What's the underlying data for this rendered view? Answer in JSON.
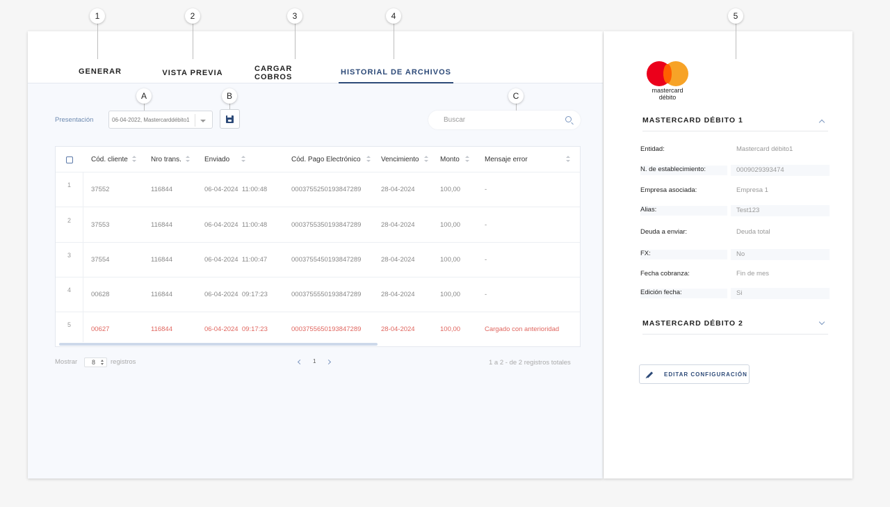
{
  "callouts": [
    "1",
    "2",
    "3",
    "4",
    "5",
    "A",
    "B",
    "C"
  ],
  "tabs": [
    {
      "label": "GENERAR",
      "active": false
    },
    {
      "label": "VISTA PREVIA",
      "active": false
    },
    {
      "label": "CARGAR COBROS",
      "active": false
    },
    {
      "label": "HISTORIAL DE ARCHIVOS",
      "active": true
    }
  ],
  "toolbar": {
    "presentacion_label": "Presentación",
    "presentacion_value": "06-04-2022, Mastercarddébito1",
    "search_placeholder": "Buscar"
  },
  "table": {
    "headers": [
      "Cód. cliente",
      "Nro trans.",
      "Enviado",
      "Cód. Pago Electrónico",
      "Vencimiento",
      "Monto",
      "Mensaje error"
    ],
    "rows": [
      {
        "idx": "1",
        "cliente": "37552",
        "trans": "116844",
        "enviado": "06-04-2024  11:00:48",
        "pago": "0003755250193847289",
        "venc": "28-04-2024",
        "monto": "100,00",
        "error": "-",
        "is_error": false
      },
      {
        "idx": "2",
        "cliente": "37553",
        "trans": "116844",
        "enviado": "06-04-2024  11:00:48",
        "pago": "0003755350193847289",
        "venc": "28-04-2024",
        "monto": "100,00",
        "error": "-",
        "is_error": false
      },
      {
        "idx": "3",
        "cliente": "37554",
        "trans": "116844",
        "enviado": "06-04-2024  11:00:47",
        "pago": "0003755450193847289",
        "venc": "28-04-2024",
        "monto": "100,00",
        "error": "-",
        "is_error": false
      },
      {
        "idx": "4",
        "cliente": "00628",
        "trans": "116844",
        "enviado": "06-04-2024  09:17:23",
        "pago": "0003755550193847289",
        "venc": "28-04-2024",
        "monto": "100,00",
        "error": "-",
        "is_error": false
      },
      {
        "idx": "5",
        "cliente": "00627",
        "trans": "116844",
        "enviado": "06-04-2024  09:17:23",
        "pago": "0003755650193847289",
        "venc": "28-04-2024",
        "monto": "100,00",
        "error": "Cargado con anterioridad",
        "is_error": true
      }
    ]
  },
  "footer": {
    "mostrar": "Mostrar",
    "per_page": "8",
    "registros": "registros",
    "page": "1",
    "summary": "1 a 2 - de 2 registros totales"
  },
  "side": {
    "logo_line1": "mastercard",
    "logo_line2": "débito",
    "section1_title": "MASTERCARD DÉBITO 1",
    "fields": [
      {
        "label": "Entidad:",
        "value": "Mastercard débito1"
      },
      {
        "label": "N. de establecimiento:",
        "value": "0009029393474"
      },
      {
        "label": "Empresa asociada:",
        "value": "Empresa 1"
      },
      {
        "label": "Alias:",
        "value": "Test123"
      },
      {
        "label": "Deuda a enviar:",
        "value": "Deuda total"
      },
      {
        "label": "FX:",
        "value": "No"
      },
      {
        "label": "Fecha cobranza:",
        "value": "Fin de mes"
      },
      {
        "label": "Edición fecha:",
        "value": "Si"
      }
    ],
    "section2_title": "MASTERCARD DÉBITO 2",
    "edit_button": "EDITAR CONFIGURACIÓN"
  },
  "colors": {
    "accent": "#2d4a78",
    "error": "#e0665f",
    "mastercard_red": "#eb001b",
    "mastercard_orange": "#f79e1b"
  }
}
